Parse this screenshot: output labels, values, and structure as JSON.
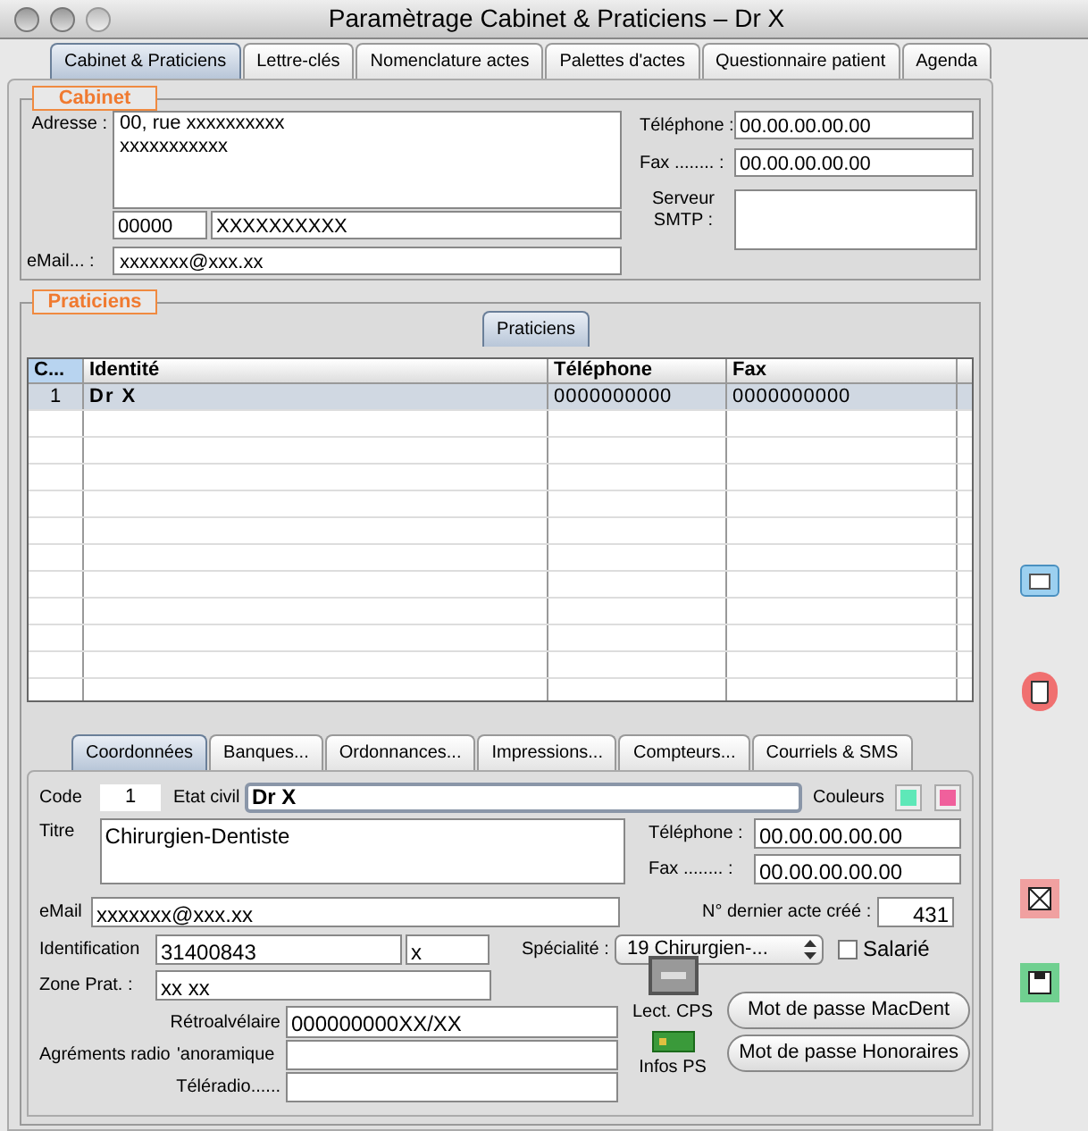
{
  "window": {
    "title": "Paramètrage Cabinet & Praticiens – Dr X"
  },
  "tabs": [
    {
      "label": "Cabinet & Praticiens",
      "selected": true
    },
    {
      "label": "Lettre-clés",
      "selected": false
    },
    {
      "label": "Nomenclature actes",
      "selected": false
    },
    {
      "label": "Palettes d'actes",
      "selected": false
    },
    {
      "label": "Questionnaire patient",
      "selected": false
    },
    {
      "label": "Agenda",
      "selected": false
    }
  ],
  "cabinet": {
    "legend": "Cabinet",
    "address_label": "Adresse :",
    "address": "00, rue xxxxxxxxxx\nxxxxxxxxxxx",
    "postal_code": "00000",
    "city": "XXXXXXXXXX",
    "email_label": "eMail... :",
    "email": "xxxxxxx@xxx.xx",
    "phone_label": "Téléphone :",
    "phone": "00.00.00.00.00",
    "fax_label": "Fax ........ :",
    "fax": "00.00.00.00.00",
    "smtp_label": "Serveur SMTP :"
  },
  "praticiens": {
    "legend": "Praticiens",
    "inner_tab": {
      "label": "Praticiens",
      "selected": true
    },
    "table": {
      "columns": [
        "C...",
        "Identité",
        "Téléphone",
        "Fax"
      ],
      "rows": [
        {
          "cells": [
            "1",
            "Dr X",
            "0000000000",
            "0000000000"
          ],
          "selected": true
        }
      ]
    }
  },
  "detail_tabs": [
    {
      "label": "Coordonnées",
      "selected": true
    },
    {
      "label": "Banques...",
      "selected": false
    },
    {
      "label": "Ordonnances...",
      "selected": false
    },
    {
      "label": "Impressions...",
      "selected": false
    },
    {
      "label": "Compteurs...",
      "selected": false
    },
    {
      "label": "Courriels & SMS",
      "selected": false
    }
  ],
  "detail": {
    "code_label": "Code",
    "code": "1",
    "etat_label": "Etat civil",
    "etat": "Dr X",
    "colors_label": "Couleurs",
    "colors": [
      {
        "color": "#5ee8b8"
      },
      {
        "color": "#f0609c"
      }
    ],
    "titre_label": "Titre",
    "titre": "Chirurgien-Dentiste",
    "phone_label": "Téléphone :",
    "phone": "00.00.00.00.00",
    "fax_label": "Fax ........ :",
    "fax": "00.00.00.00.00",
    "email_label": "eMail",
    "email": "xxxxxxx@xxx.xx",
    "last_act_label": "N° dernier acte créé :",
    "last_act": "431",
    "ident_label": "Identification",
    "ident": "31400843",
    "ident_key": "x",
    "specialite_label": "Spécialité :",
    "specialite": "19 Chirurgien-...",
    "salarie": {
      "label": "Salarié",
      "checked": false
    },
    "zone_label": "Zone Prat. :",
    "zone": "xx xx",
    "retro_label": "Rétroalvélaire",
    "retro": "000000000XX/XX",
    "agrements_label": "Agréments radio",
    "pano_label": "'anoramique",
    "teleradio_label": "Téléradio......",
    "lect_label": "Lect. CPS",
    "infos_label": "Infos PS",
    "buttons": [
      "Mot de passe MacDent",
      "Mot de passe Honoraires"
    ]
  }
}
